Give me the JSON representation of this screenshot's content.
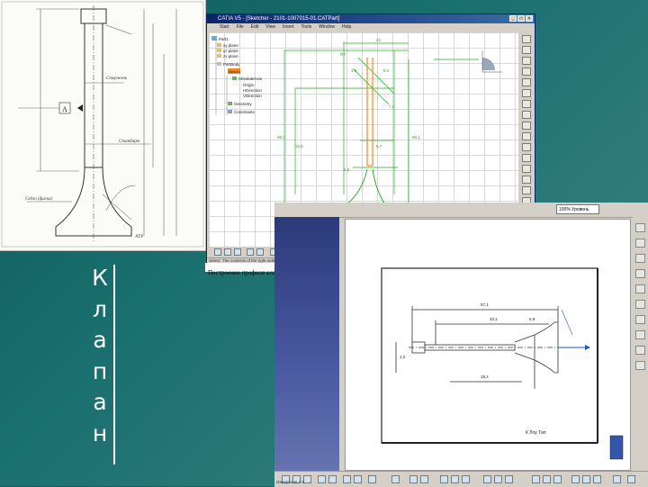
{
  "slide": {
    "title_letters": [
      "К",
      "л",
      "а",
      "п",
      "а",
      "н"
    ]
  },
  "catia": {
    "window_title": "CATIA V5 - [Sketcher - 2101-1007015-01.CATPart]",
    "menu": [
      "Start",
      "File",
      "Edit",
      "View",
      "Insert",
      "Tools",
      "Window",
      "Help"
    ],
    "tree": [
      "Part1",
      "xy plane",
      "yz plane",
      "zx plane",
      "PartBody",
      "Sketch.1",
      "AbsoluteAxis",
      "Origin",
      "HDirection",
      "VDirection",
      "Geometry",
      "Constraints"
    ],
    "dimensions": [
      "24",
      "R7",
      "1,8",
      "0,4",
      "7,2",
      "68,1",
      "15,5",
      "68,1",
      "5,7",
      "5,6",
      "7,7",
      "0,8"
    ],
    "status_text": "Select: The contents of the right-side area are selected/moved/modified"
  },
  "caption": {
    "text": "Построение профиля клапана в области Sketcher."
  },
  "cad2": {
    "zoom_value": "100% Уровень",
    "dimensions": [
      "57,1",
      "40,1",
      "5,9",
      "1,2",
      "18,4"
    ],
    "stamp_text": "К Лоу Тип",
    "status_text": "Измерение 4 9"
  },
  "paper": {
    "labels": [
      "A",
      "Стержень",
      "Стандарт",
      "Седло (фаска)",
      "АТР"
    ]
  }
}
